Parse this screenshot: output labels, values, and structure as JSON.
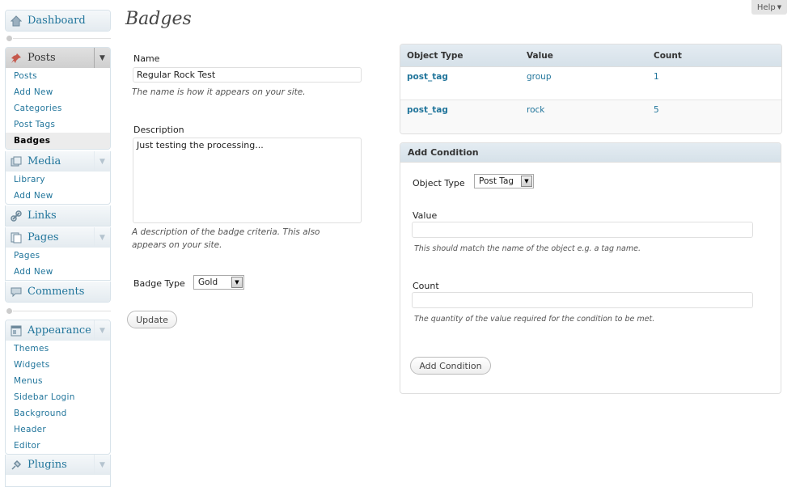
{
  "sidebar": {
    "dashboard": "Dashboard",
    "posts": {
      "label": "Posts",
      "items": [
        "Posts",
        "Add New",
        "Categories",
        "Post Tags",
        "Badges"
      ]
    },
    "media": {
      "label": "Media",
      "items": [
        "Library",
        "Add New"
      ]
    },
    "links": {
      "label": "Links"
    },
    "pages": {
      "label": "Pages",
      "items": [
        "Pages",
        "Add New"
      ]
    },
    "comments": {
      "label": "Comments"
    },
    "appearance": {
      "label": "Appearance",
      "items": [
        "Themes",
        "Widgets",
        "Menus",
        "Sidebar Login",
        "Background",
        "Header",
        "Editor"
      ]
    },
    "plugins": {
      "label": "Plugins"
    }
  },
  "help": {
    "label": "Help"
  },
  "page_title": "Badges",
  "form": {
    "name_label": "Name",
    "name_value": "Regular Rock Test",
    "name_hint": "The name is how it appears on your site.",
    "description_label": "Description",
    "description_value": "Just testing the processing...",
    "description_hint_line1": "A description of the badge criteria. This also",
    "description_hint_line2": "appears on your site.",
    "badge_type_label": "Badge Type",
    "badge_type_value": "Gold",
    "update_label": "Update"
  },
  "conditions_table": {
    "headers": [
      "Object Type",
      "Value",
      "Count"
    ],
    "rows": [
      [
        "post_tag",
        "group",
        "1"
      ],
      [
        "post_tag",
        "rock",
        "5"
      ]
    ]
  },
  "add_condition": {
    "title": "Add Condition",
    "object_type_label": "Object Type",
    "object_type_value": "Post Tag",
    "value_label": "Value",
    "value_value": "",
    "value_hint": "This should match the name of the object e.g. a tag name.",
    "count_label": "Count",
    "count_value": "",
    "count_hint": "The quantity of the value required for the condition to be met.",
    "button_label": "Add Condition"
  },
  "colors": {
    "link": "#21759b",
    "heading": "#464646",
    "table_header_bg": "#d6e1e9"
  }
}
